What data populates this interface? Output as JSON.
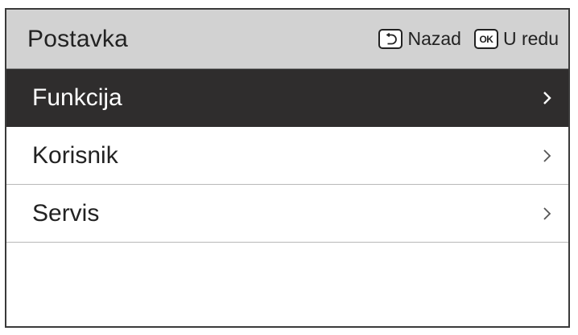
{
  "header": {
    "title": "Postavka",
    "back_label": "Nazad",
    "ok_icon_text": "OK",
    "ok_label": "U redu"
  },
  "menu": {
    "items": [
      {
        "label": "Funkcija",
        "selected": true
      },
      {
        "label": "Korisnik",
        "selected": false
      },
      {
        "label": "Servis",
        "selected": false
      }
    ]
  },
  "colors": {
    "header_bg": "#d2d2d2",
    "selected_bg": "#2f2d2d",
    "text": "#222222"
  }
}
